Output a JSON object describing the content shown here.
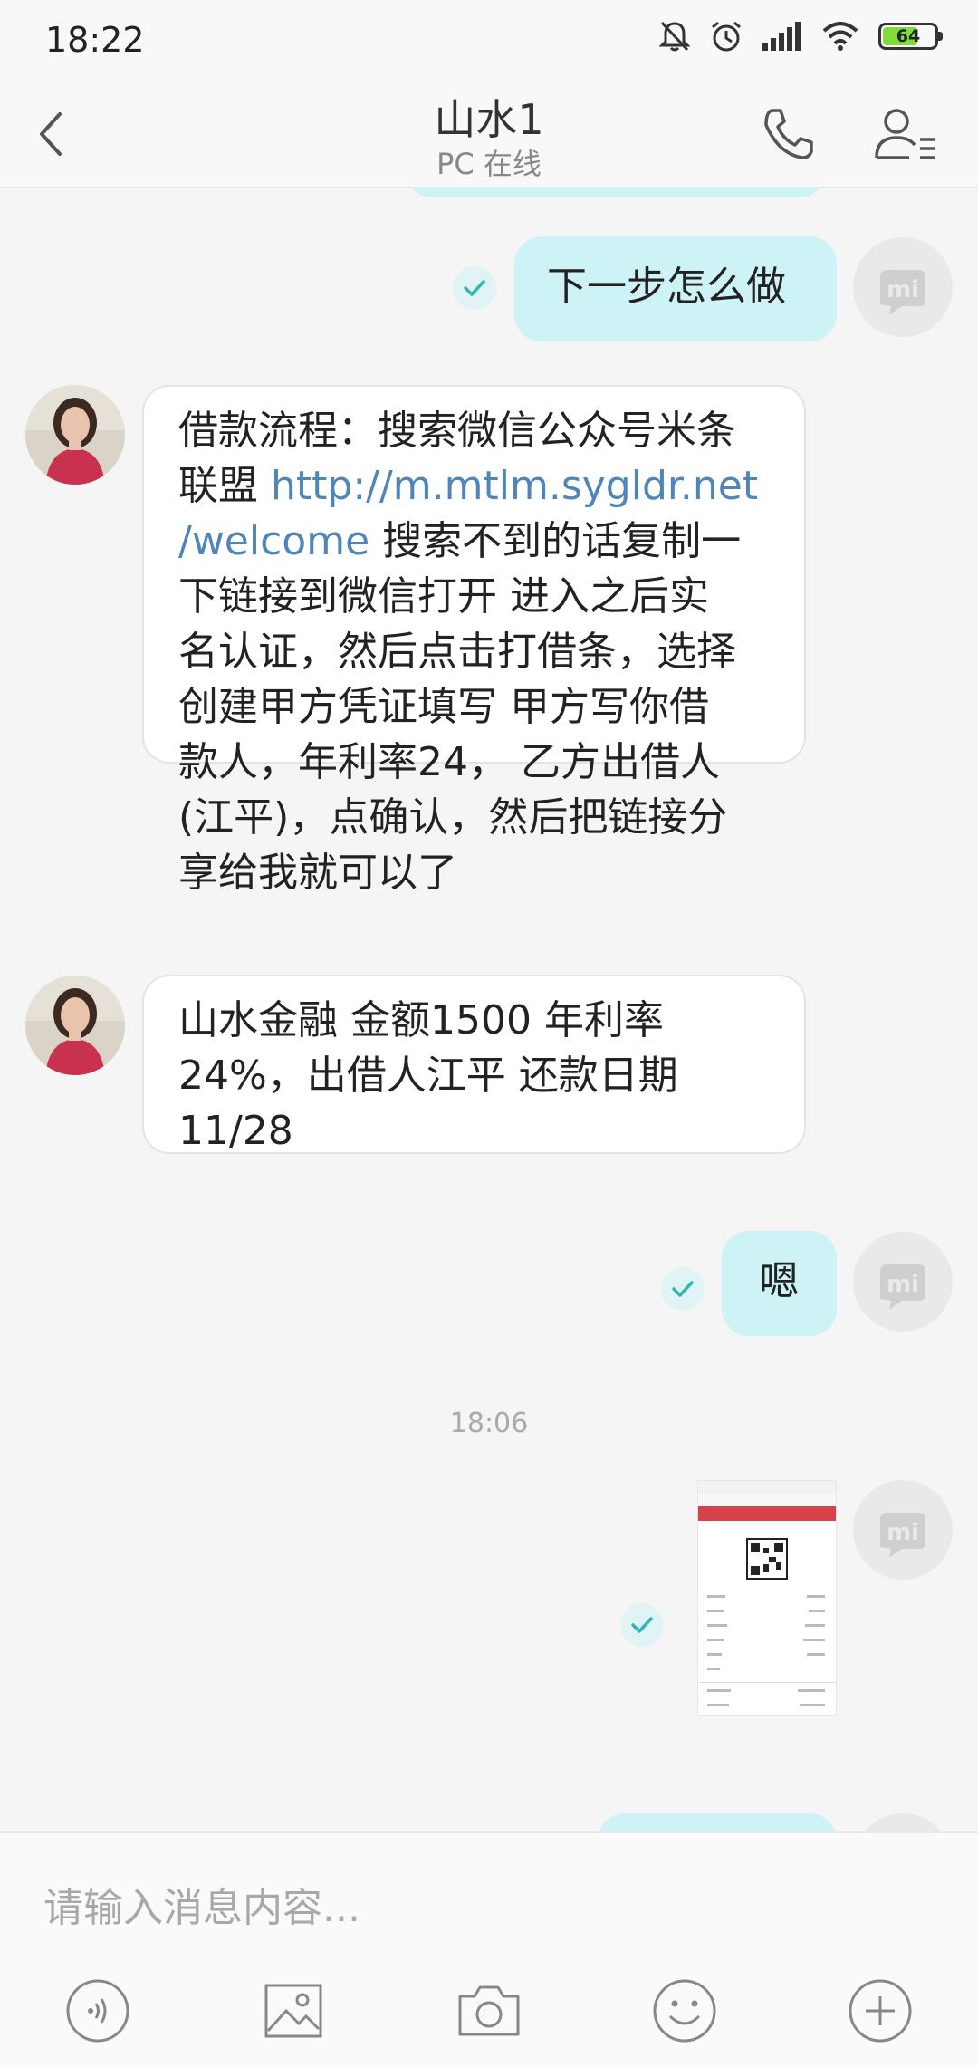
{
  "status_bar": {
    "time": "18:22",
    "battery": "64"
  },
  "header": {
    "title": "山水1",
    "subtitle": "PC 在线"
  },
  "messages": [
    {
      "side": "out",
      "text": "下一步怎么做"
    },
    {
      "side": "in",
      "lines": [
        "借款流程：搜索微信公众号米条",
        "联盟  ",
        "http://m.mtlm.sygldr.net",
        "/welcome",
        " 搜索不到的话复制一",
        "下链接到微信打开 进入之后实",
        "名认证，然后点击打借条，选择",
        "创建甲方凭证填写 甲方写你借",
        "款人，年利率24，  乙方出借人",
        "(江平)，点确认，然后把链接分",
        "享给我就可以了"
      ]
    },
    {
      "side": "in",
      "lines": [
        "山水金融    金额1500   年利率",
        "24%，出借人江平 还款日期",
        "11/28"
      ]
    },
    {
      "side": "out",
      "text": "嗯"
    }
  ],
  "timestamp": "18:06",
  "input": {
    "placeholder": "请输入消息内容..."
  },
  "icons": {
    "back": "chevron-left-icon",
    "phone": "phone-icon",
    "profile": "contact-profile-icon",
    "voice": "voice-icon",
    "image": "image-icon",
    "camera": "camera-icon",
    "emoji": "emoji-icon",
    "plus": "plus-icon"
  },
  "colors": {
    "out_bubble": "#cdf3f6",
    "link": "#4f86b9",
    "battery": "#7fdc3a"
  }
}
